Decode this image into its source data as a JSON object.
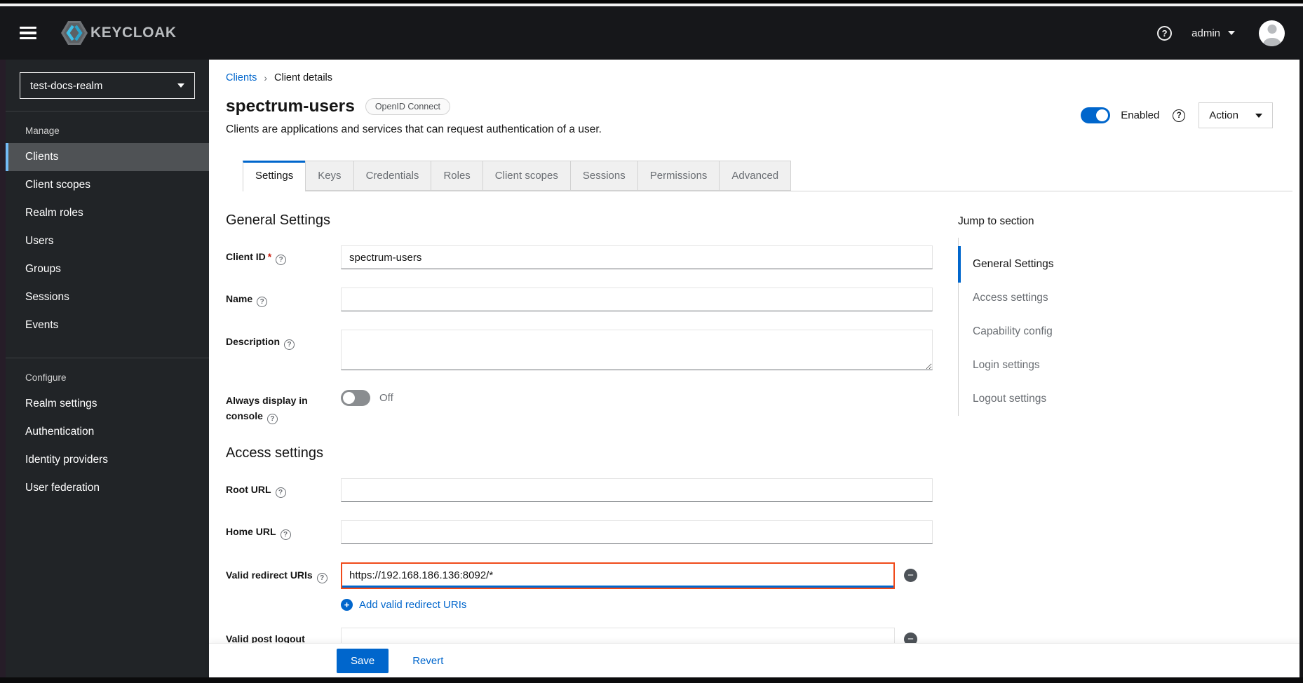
{
  "icons": {
    "question": "?",
    "chevron_right": "›",
    "minus": "−",
    "plus": "+"
  },
  "colors": {
    "accent_blue": "#0066cc",
    "masthead_bg": "#16171a",
    "sidebar_bg": "#212427",
    "sidebar_active_bar": "#73bcf7",
    "highlight_orange": "#f04a1a",
    "danger_red": "#c9190b"
  },
  "masthead": {
    "brand": "KEYCLOAK",
    "username": "admin"
  },
  "sidebar": {
    "realm": "test-docs-realm",
    "groups": [
      {
        "label": "Manage",
        "items": [
          "Clients",
          "Client scopes",
          "Realm roles",
          "Users",
          "Groups",
          "Sessions",
          "Events"
        ]
      },
      {
        "label": "Configure",
        "items": [
          "Realm settings",
          "Authentication",
          "Identity providers",
          "User federation"
        ]
      }
    ],
    "active_item": "Clients"
  },
  "breadcrumb": {
    "parent": "Clients",
    "current": "Client details"
  },
  "header": {
    "title": "spectrum-users",
    "badge": "OpenID Connect",
    "subtitle": "Clients are applications and services that can request authentication of a user.",
    "enabled_label": "Enabled",
    "action_label": "Action"
  },
  "tabs": [
    "Settings",
    "Keys",
    "Credentials",
    "Roles",
    "Client scopes",
    "Sessions",
    "Permissions",
    "Advanced"
  ],
  "active_tab": "Settings",
  "general_settings": {
    "heading": "General Settings",
    "client_id": {
      "label": "Client ID",
      "required_marker": "*",
      "value": "spectrum-users"
    },
    "name": {
      "label": "Name",
      "value": ""
    },
    "description": {
      "label": "Description",
      "value": ""
    },
    "always_display": {
      "label": "Always display in console",
      "state": "Off"
    }
  },
  "access_settings": {
    "heading": "Access settings",
    "root_url": {
      "label": "Root URL",
      "value": ""
    },
    "home_url": {
      "label": "Home URL",
      "value": ""
    },
    "valid_redirect_uris": {
      "label": "Valid redirect URIs",
      "value": "https://192.168.186.136:8092/*",
      "add_label": "Add valid redirect URIs"
    },
    "valid_post_logout": {
      "label": "Valid post logout",
      "value": ""
    }
  },
  "jump_to_section": {
    "title": "Jump to section",
    "items": [
      "General Settings",
      "Access settings",
      "Capability config",
      "Login settings",
      "Logout settings"
    ],
    "active": "General Settings"
  },
  "footer": {
    "save": "Save",
    "revert": "Revert"
  }
}
